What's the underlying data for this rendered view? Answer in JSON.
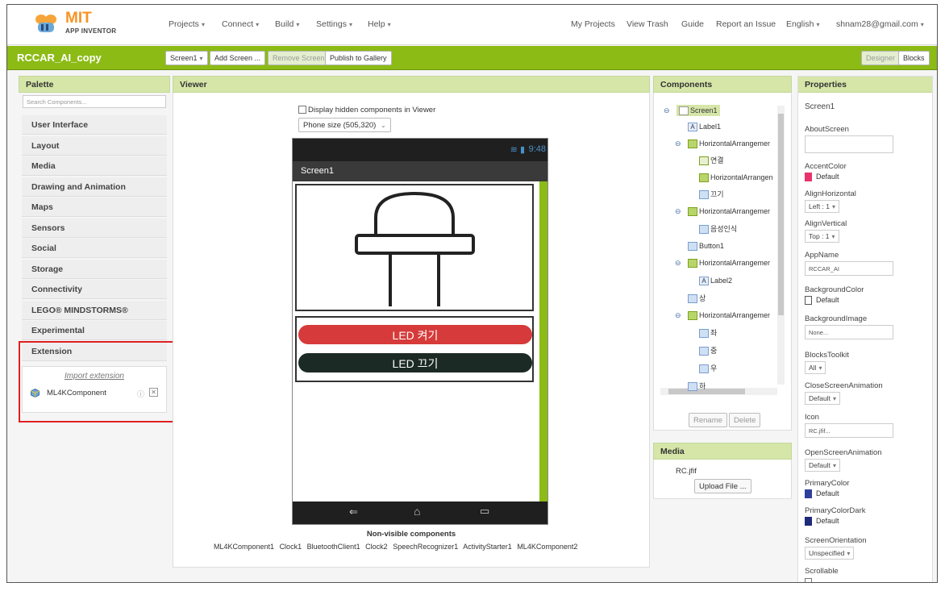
{
  "brand": {
    "name": "MIT",
    "sub": "APP INVENTOR"
  },
  "top_nav": {
    "left": [
      "Projects",
      "Connect",
      "Build",
      "Settings",
      "Help"
    ],
    "right": {
      "my_projects": "My Projects",
      "view_trash": "View Trash",
      "guide": "Guide",
      "report": "Report an Issue",
      "language": "English",
      "account": "shnam28@gmail.com"
    }
  },
  "project": {
    "name": "RCCAR_AI_copy",
    "screen_select": "Screen1",
    "add_screen": "Add Screen ...",
    "remove_screen": "Remove Screen",
    "publish": "Publish to Gallery",
    "designer": "Designer",
    "blocks": "Blocks"
  },
  "palette": {
    "title": "Palette",
    "search_placeholder": "Search Components...",
    "categories": [
      "User Interface",
      "Layout",
      "Media",
      "Drawing and Animation",
      "Maps",
      "Sensors",
      "Social",
      "Storage",
      "Connectivity",
      "LEGO® MINDSTORMS®",
      "Experimental",
      "Extension"
    ],
    "import_extension": "Import extension",
    "extension_item": "ML4KComponent"
  },
  "viewer": {
    "title": "Viewer",
    "hidden_checkbox": "Display hidden components in Viewer",
    "phone_size": "Phone size (505,320)",
    "status_time": "9:48",
    "screen_title": "Screen1",
    "led_on": "LED 켜기",
    "led_off": "LED 끄기",
    "nonvisible_title": "Non-visible components",
    "nonvisible": [
      "ML4KComponent1",
      "Clock1",
      "BluetoothClient1",
      "Clock2",
      "SpeechRecognizer1",
      "ActivityStarter1",
      "ML4KComponent2"
    ]
  },
  "components": {
    "title": "Components",
    "tree": {
      "screen1": "Screen1",
      "label1": "Label1",
      "ha1": "HorizontalArrangemer",
      "connect": "연결",
      "ha_inner": "HorizontalArrangen",
      "off": "끄기",
      "ha2": "HorizontalArrangemer",
      "voice": "음성인식",
      "button1": "Button1",
      "ha3": "HorizontalArrangemer",
      "label2": "Label2",
      "up": "상",
      "ha4": "HorizontalArrangemer",
      "left": "좌",
      "center": "중",
      "right": "우",
      "down": "하"
    },
    "rename": "Rename",
    "delete": "Delete"
  },
  "media": {
    "title": "Media",
    "file": "RC.jfif",
    "upload": "Upload File ..."
  },
  "properties": {
    "title": "Properties",
    "screen": "Screen1",
    "about_screen": "AboutScreen",
    "accent_color": "AccentColor",
    "accent_value": "Default",
    "align_h": "AlignHorizontal",
    "align_h_value": "Left : 1",
    "align_v": "AlignVertical",
    "align_v_value": "Top : 1",
    "app_name": "AppName",
    "app_name_value": "RCCAR_AI",
    "bg_color": "BackgroundColor",
    "bg_color_value": "Default",
    "bg_image": "BackgroundImage",
    "bg_image_value": "None...",
    "blocks_toolkit": "BlocksToolkit",
    "blocks_toolkit_value": "All",
    "close_anim": "CloseScreenAnimation",
    "close_anim_value": "Default",
    "icon": "Icon",
    "icon_value": "RC.jfif...",
    "open_anim": "OpenScreenAnimation",
    "open_anim_value": "Default",
    "primary_color": "PrimaryColor",
    "primary_color_value": "Default",
    "primary_dark": "PrimaryColorDark",
    "primary_dark_value": "Default",
    "orientation": "ScreenOrientation",
    "orientation_value": "Unspecified",
    "scrollable": "Scrollable"
  },
  "colors": {
    "brand_green": "#8cbb15",
    "accent_pink": "#e8336d",
    "primary_blue": "#2f3f9e",
    "led_red": "#d63a3a",
    "led_dark": "#1c2a26",
    "highlight_red": "#e02020"
  }
}
